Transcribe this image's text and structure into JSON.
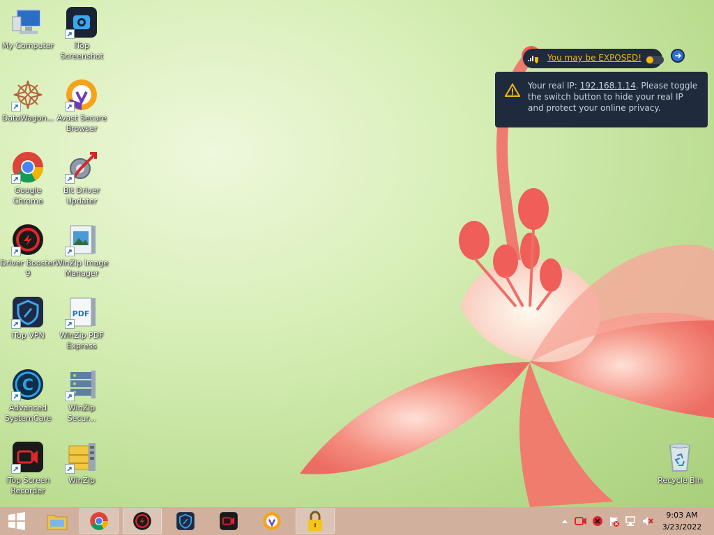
{
  "desktop": {
    "icons": [
      {
        "label": "My Computer"
      },
      {
        "label": "iTop Screenshot"
      },
      {
        "label": "DataWagon..."
      },
      {
        "label": "Avast Secure Browser"
      },
      {
        "label": "Google Chrome"
      },
      {
        "label": "Bit Driver Updater"
      },
      {
        "label": "Driver Booster 9"
      },
      {
        "label": "WinZip Image Manager"
      },
      {
        "label": "iTop VPN"
      },
      {
        "label": "WinZip PDF Express"
      },
      {
        "label": "Advanced SystemCare"
      },
      {
        "label": "WinZip Secur..."
      },
      {
        "label": "iTop Screen Recorder"
      },
      {
        "label": "WinZip"
      },
      {
        "label": "Recycle Bin"
      }
    ]
  },
  "vpn_popup": {
    "exposed_text": "You may be EXPOSED!",
    "toggle_state": "off",
    "tip_prefix": "Your real IP: ",
    "ip": "192.168.1.14",
    "tip_suffix": ". Please toggle the switch button to hide your real IP and protect your online privacy.",
    "accent_color": "#f5b70f",
    "bg_color": "#1f2a3c"
  },
  "taskbar": {
    "pinned": [
      "windows-start-icon",
      "file-explorer-icon",
      "chrome-icon",
      "driver-booster-icon",
      "itop-vpn-icon",
      "itop-screen-recorder-icon",
      "avast-browser-icon",
      "lock-icon"
    ],
    "tray_icons": [
      "show-hidden-icons",
      "itop-recorder-tray-icon",
      "stop-tray-icon",
      "action-center-flag-icon",
      "network-icon",
      "volume-muted-icon"
    ],
    "time": "9:03 AM",
    "date": "3/23/2022"
  }
}
